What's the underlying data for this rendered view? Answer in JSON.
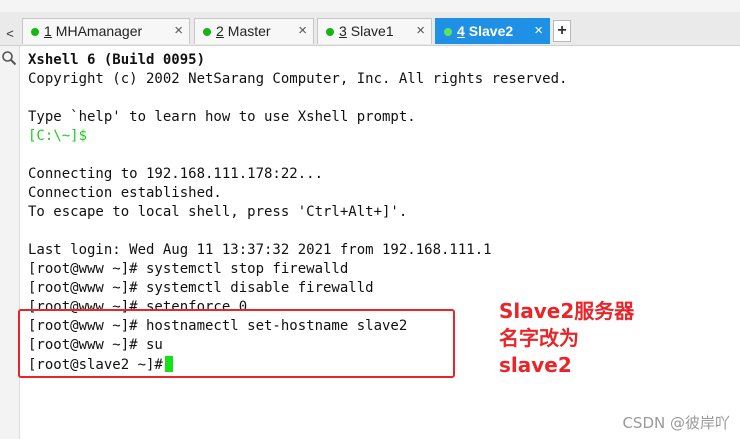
{
  "tabs": [
    {
      "number": "1",
      "title": "MHAmanager",
      "active": false
    },
    {
      "number": "2",
      "title": "Master",
      "active": false
    },
    {
      "number": "3",
      "title": "Slave1",
      "active": false
    },
    {
      "number": "4",
      "title": "Slave2",
      "active": true
    }
  ],
  "tab_close_glyph": "×",
  "add_tab_glyph": "+",
  "left_arrow_glyph": "<",
  "terminal": {
    "banner_title": "Xshell 6 (Build 0095)",
    "copyright": "Copyright (c) 2002 NetSarang Computer, Inc. All rights reserved.",
    "help_line": "Type `help' to learn how to use Xshell prompt.",
    "local_prompt": "[C:\\~]$",
    "connecting": "Connecting to 192.168.111.178:22...",
    "established": "Connection established.",
    "escape_hint": "To escape to local shell, press 'Ctrl+Alt+]'.",
    "last_login": "Last login: Wed Aug 11 13:37:32 2021 from 192.168.111.1",
    "commands": [
      "[root@www ~]# systemctl stop firewalld",
      "[root@www ~]# systemctl disable firewalld",
      "[root@www ~]# setenforce 0",
      "[root@www ~]# hostnamectl set-hostname slave2",
      "[root@www ~]# su",
      "[root@slave2 ~]#"
    ]
  },
  "annotation": {
    "lines": [
      "Slave2服务器",
      "名字改为",
      "slave2"
    ]
  },
  "watermark": "CSDN @彼岸吖",
  "colors": {
    "accent": "#1e90e6",
    "prompt_green": "#1fcc1f",
    "annotation_red": "#e8262a"
  }
}
